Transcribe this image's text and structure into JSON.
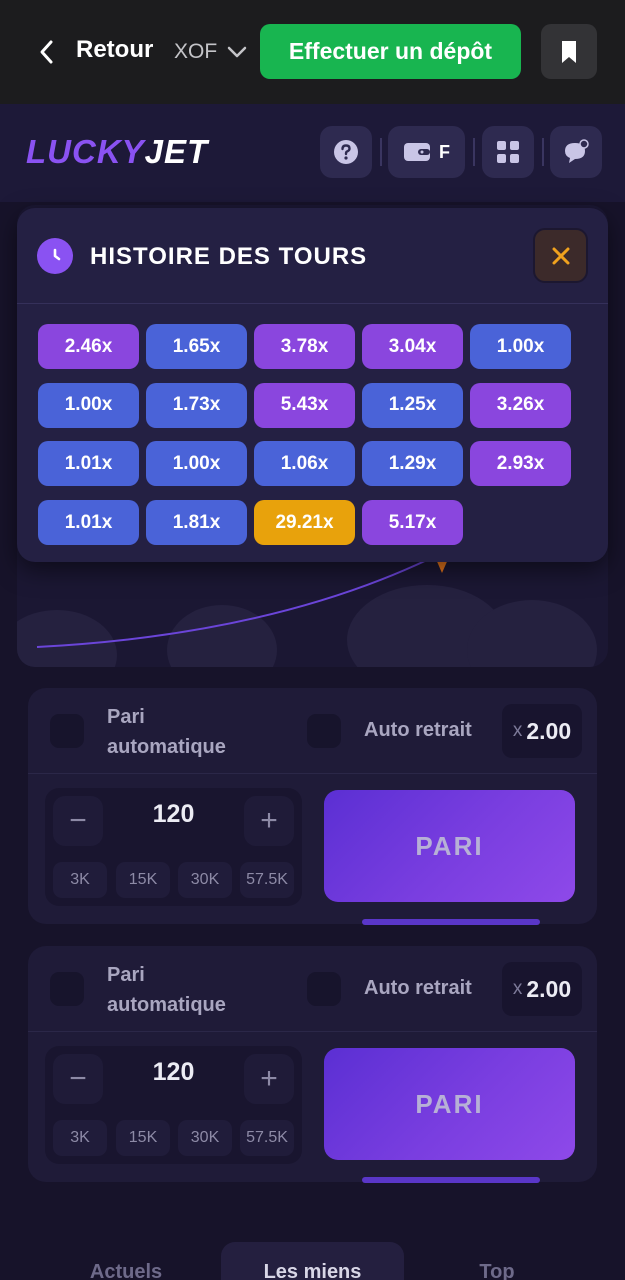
{
  "topbar": {
    "back_label": "Retour",
    "currency": "XOF",
    "deposit_label": "Effectuer un dépôt"
  },
  "header": {
    "logo_part1": "LUCKY",
    "logo_part2": "JET",
    "wallet_label": "F"
  },
  "history": {
    "title": "HISTOIRE DES TOURS",
    "chips": [
      {
        "value": "2.46x",
        "color": "#8a46de"
      },
      {
        "value": "1.65x",
        "color": "#4a63d8"
      },
      {
        "value": "3.78x",
        "color": "#8a46de"
      },
      {
        "value": "3.04x",
        "color": "#8a46de"
      },
      {
        "value": "1.00x",
        "color": "#4a63d8"
      },
      {
        "value": "1.00x",
        "color": "#4a63d8"
      },
      {
        "value": "1.73x",
        "color": "#4a63d8"
      },
      {
        "value": "5.43x",
        "color": "#8a46de"
      },
      {
        "value": "1.25x",
        "color": "#4a63d8"
      },
      {
        "value": "3.26x",
        "color": "#8a46de"
      },
      {
        "value": "1.01x",
        "color": "#4a63d8"
      },
      {
        "value": "1.00x",
        "color": "#4a63d8"
      },
      {
        "value": "1.06x",
        "color": "#4a63d8"
      },
      {
        "value": "1.29x",
        "color": "#4a63d8"
      },
      {
        "value": "2.93x",
        "color": "#8a46de"
      },
      {
        "value": "1.01x",
        "color": "#4a63d8"
      },
      {
        "value": "1.81x",
        "color": "#4a63d8"
      },
      {
        "value": "29.21x",
        "color": "#e8a20c"
      },
      {
        "value": "5.17x",
        "color": "#8a46de"
      }
    ]
  },
  "bets": [
    {
      "auto_bet_label": "Pari automatique",
      "auto_cashout_label": "Auto retrait",
      "multiplier_prefix": "x",
      "multiplier": "2.00",
      "amount": "120",
      "minus": "−",
      "plus": "+",
      "quick": [
        "3K",
        "15K",
        "30K",
        "57.5K"
      ],
      "bet_label": "PARI"
    },
    {
      "auto_bet_label": "Pari automatique",
      "auto_cashout_label": "Auto retrait",
      "multiplier_prefix": "x",
      "multiplier": "2.00",
      "amount": "120",
      "minus": "−",
      "plus": "+",
      "quick": [
        "3K",
        "15K",
        "30K",
        "57.5K"
      ],
      "bet_label": "PARI"
    }
  ],
  "tabs": [
    {
      "label": "Actuels",
      "active": false
    },
    {
      "label": "Les miens",
      "active": true
    },
    {
      "label": "Top",
      "active": false
    }
  ],
  "colors": {
    "accent": "#8a52f2",
    "deposit": "#18b550"
  }
}
